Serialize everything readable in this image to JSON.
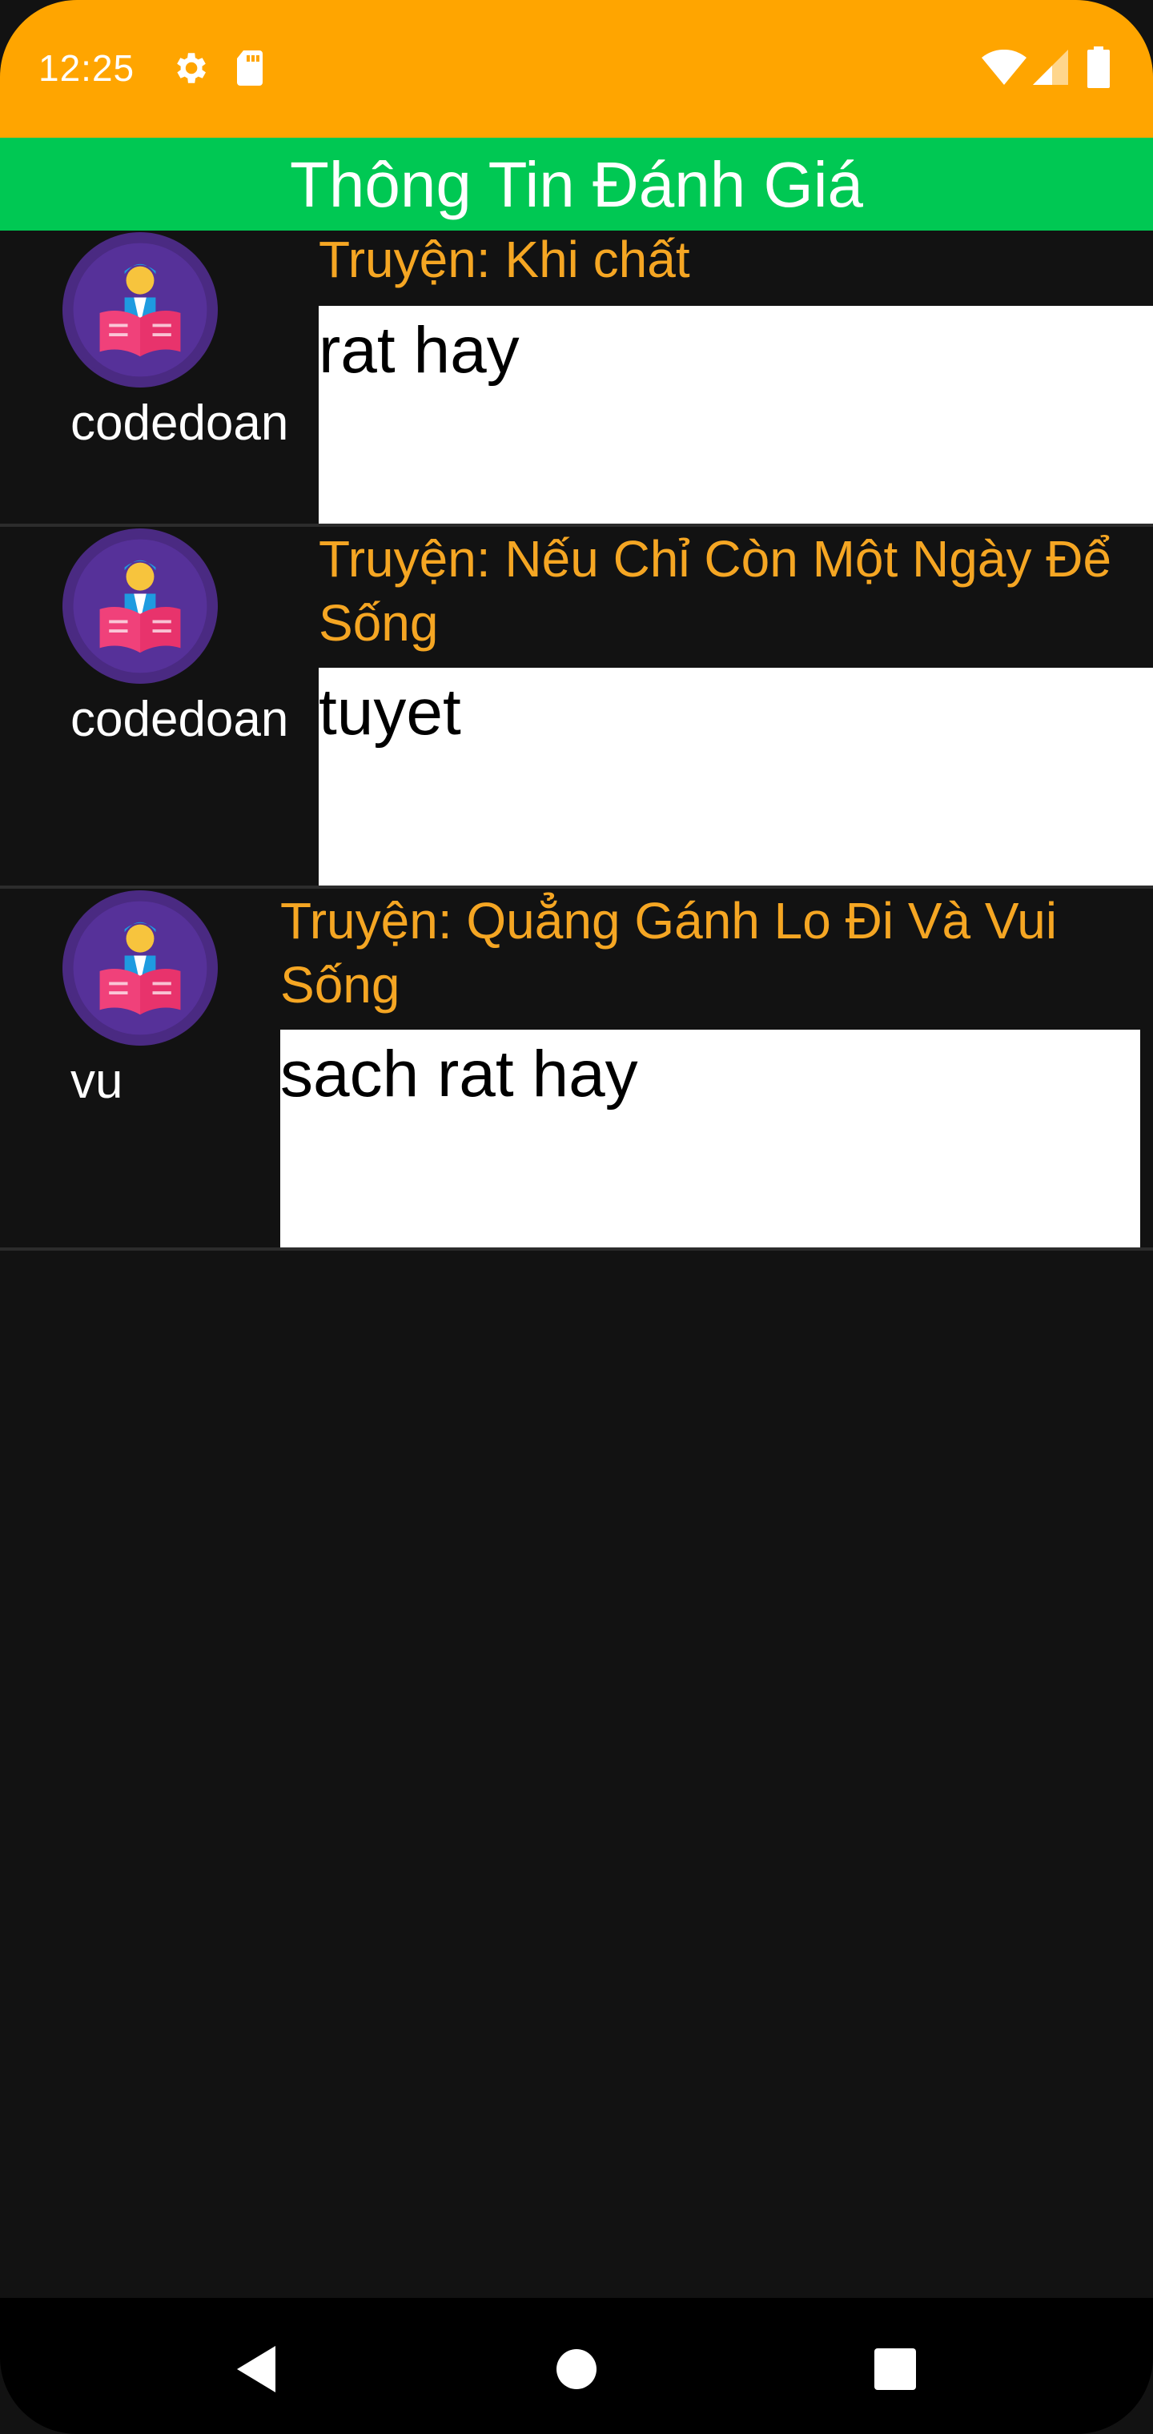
{
  "status_bar": {
    "time": "12:25",
    "color": "#FFA500",
    "icons": [
      "settings-icon",
      "sd-card-icon",
      "wifi-icon",
      "signal-icon",
      "battery-icon"
    ]
  },
  "header": {
    "title": "Thông Tin Đánh Giá",
    "color": "#00C853"
  },
  "reviews": [
    {
      "user": "codedoan",
      "story": "Truyện: Khi chất",
      "comment": "rat hay",
      "avatar_icon": "reader-avatar-icon"
    },
    {
      "user": "codedoan",
      "story": "Truyện: Nếu Chỉ Còn Một Ngày Để Sống",
      "comment": "tuyet",
      "avatar_icon": "reader-avatar-icon"
    },
    {
      "user": "vu",
      "story": "Truyện: Quẳng Gánh Lo Đi Và Vui Sống",
      "comment": "sach rat hay",
      "avatar_icon": "reader-avatar-icon"
    }
  ],
  "nav_bar": {
    "icons": [
      "back-icon",
      "home-icon",
      "recents-icon"
    ]
  },
  "colors": {
    "background": "#121212",
    "story_title": "#F5A623",
    "avatar_bg": "#4A2A82"
  }
}
